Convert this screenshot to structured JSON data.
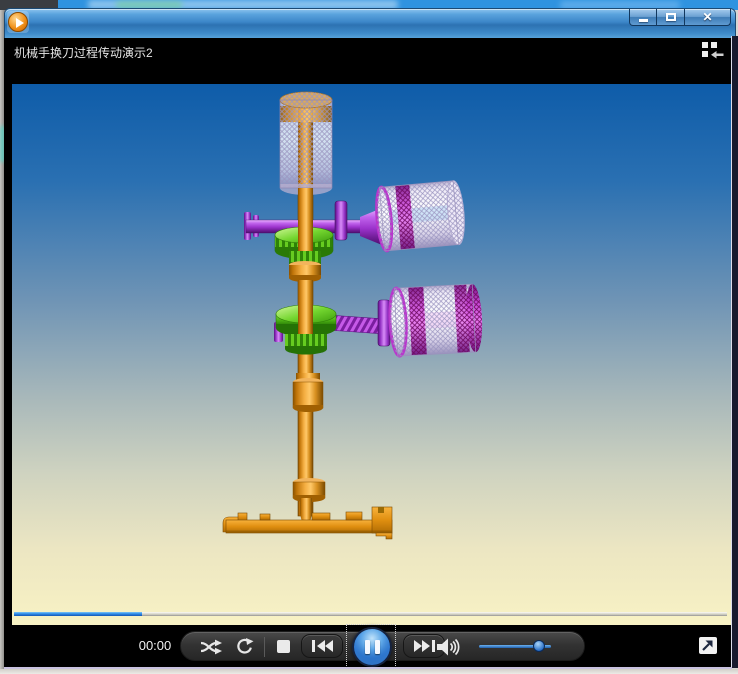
{
  "titlebar": {
    "close_glyph": "✕",
    "icons": [
      "wmp-logo",
      "minimize",
      "maximize",
      "close"
    ]
  },
  "now_playing": {
    "title": "机械手换刀过程传动演示2",
    "switch_library_icon": "switch-to-library"
  },
  "transport": {
    "elapsed_time": "00:00",
    "progress_pct": 18,
    "volume_pct": 85,
    "playback_state": "playing",
    "button_icons": [
      "shuffle",
      "repeat",
      "stop",
      "previous",
      "pause",
      "next",
      "volume",
      "fullscreen"
    ]
  },
  "colors": {
    "titlebar_blue": "#3c86c8",
    "video_bg_top": "#0e5ca9",
    "video_bg_bottom": "#f8f2c4",
    "machine_orange": "#e89a1a",
    "machine_purple": "#b44ae0",
    "machine_green": "#5ec61e",
    "motor_mesh_white": "#efeaf8",
    "motor_band_magenta": "#c94ad8",
    "seek_fill_blue": "#2f8de8",
    "pause_button_blue": "#2268c0"
  },
  "video_scene": {
    "description": "3D CAD animation of a machine tool-changer transmission",
    "parts": [
      {
        "name": "top-spindle-motor",
        "color": "#e89a1a",
        "texture": "mesh"
      },
      {
        "name": "vertical-drive-shaft",
        "color": "#e89a1a"
      },
      {
        "name": "upper-cross-shaft",
        "color": "#b44ae0"
      },
      {
        "name": "upper-gear",
        "color": "#5ec61e"
      },
      {
        "name": "upper-right-motor",
        "color": "#efeaf8",
        "texture": "mesh"
      },
      {
        "name": "lower-worm-gear",
        "color": "#5ec61e"
      },
      {
        "name": "lower-worm-shaft",
        "color": "#b44ae0"
      },
      {
        "name": "lower-right-motor",
        "color": "#efeaf8",
        "texture": "mesh"
      },
      {
        "name": "tool-gripper-arm",
        "color": "#e89a1a"
      }
    ]
  }
}
